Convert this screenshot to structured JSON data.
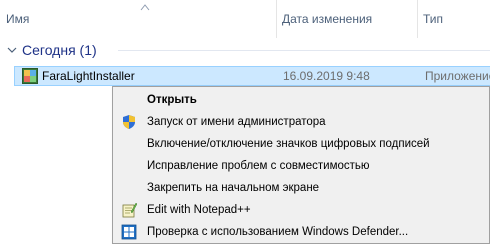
{
  "columns": {
    "name": "Имя",
    "date": "Дата изменения",
    "type": "Тип"
  },
  "group": {
    "label": "Сегодня (1)"
  },
  "file": {
    "name": "FaraLightInstaller",
    "date": "16.09.2019 9:48",
    "type": "Приложение"
  },
  "context_menu": {
    "items": [
      {
        "label": "Открыть",
        "icon": "none",
        "default": true
      },
      {
        "label": "Запуск от имени администратора",
        "icon": "uac-shield-icon"
      },
      {
        "label": "Включение/отключение значков цифровых подписей",
        "icon": "none"
      },
      {
        "label": "Исправление проблем с совместимостью",
        "icon": "none"
      },
      {
        "label": "Закрепить на начальном экране",
        "icon": "none"
      },
      {
        "label": "Edit with Notepad++",
        "icon": "notepad-plus-plus-icon"
      },
      {
        "label": "Проверка с использованием Windows Defender...",
        "icon": "windows-defender-icon"
      }
    ]
  },
  "colors": {
    "selection_bg": "#cce8ff",
    "selection_border": "#99d1ff",
    "group_header": "#1e3287",
    "menu_bg": "#f0f0f0"
  }
}
